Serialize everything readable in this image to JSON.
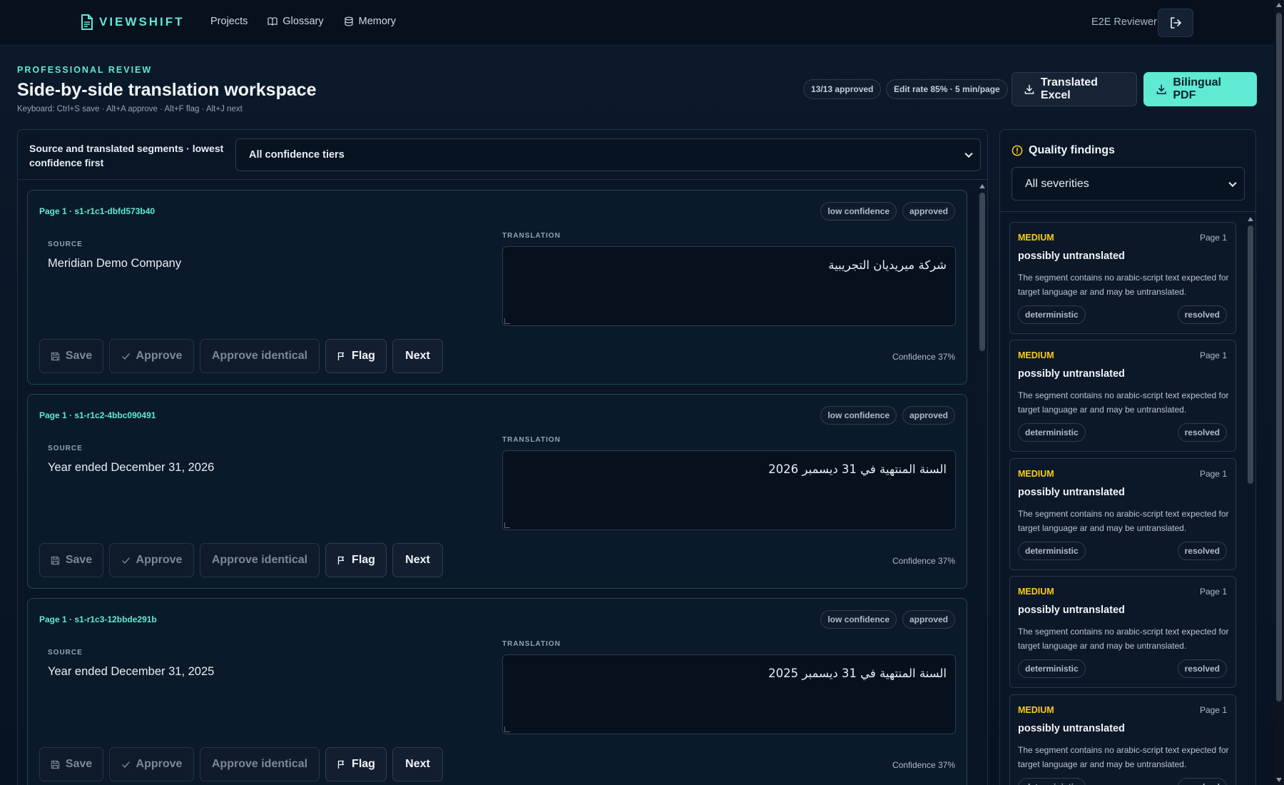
{
  "nav": {
    "brand": "VIEWSHIFT",
    "links": [
      {
        "label": "Projects",
        "icon": "none"
      },
      {
        "label": "Glossary",
        "icon": "book-icon"
      },
      {
        "label": "Memory",
        "icon": "database-icon"
      }
    ],
    "user": "E2E Reviewer",
    "logout_icon": "logout-icon"
  },
  "header": {
    "eyebrow": "PROFESSIONAL REVIEW",
    "title": "Side-by-side translation workspace",
    "shortcuts": "Keyboard: Ctrl+S save · Alt+A approve · Alt+F flag · Alt+J next",
    "approved_stat": "13/13 approved",
    "edit_stat": "Edit rate 85% · 5 min/page",
    "excel_label": "Translated Excel",
    "pdf_label": "Bilingual PDF"
  },
  "segments_panel": {
    "title": "Source and translated segments · lowest confidence first",
    "filter_value": "All confidence tiers",
    "source_label": "SOURCE",
    "translation_label": "TRANSLATION",
    "actions": {
      "save": "Save",
      "approve": "Approve",
      "approve_identical": "Approve identical",
      "flag": "Flag",
      "next": "Next"
    },
    "segments": [
      {
        "id": "Page 1 · s1-r1c1-dbfd573b40",
        "badges": [
          "low confidence",
          "approved"
        ],
        "source": "Meridian Demo Company",
        "translation": "شركة ميريديان التجريبية",
        "confidence": "Confidence 37%"
      },
      {
        "id": "Page 1 · s1-r1c2-4bbc090491",
        "badges": [
          "low confidence",
          "approved"
        ],
        "source": "Year ended December 31, 2026",
        "translation": "السنة المنتهية في 31 ديسمبر 2026",
        "confidence": "Confidence 37%"
      },
      {
        "id": "Page 1 · s1-r1c3-12bbde291b",
        "badges": [
          "low confidence",
          "approved"
        ],
        "source": "Year ended December 31, 2025",
        "translation": "السنة المنتهية في 31 ديسمبر 2025",
        "confidence": "Confidence 37%"
      }
    ]
  },
  "findings_panel": {
    "title": "Quality findings",
    "severity_filter": "All severities",
    "findings": [
      {
        "severity": "MEDIUM",
        "page": "Page 1",
        "title": "possibly untranslated",
        "desc": "The segment contains no arabic-script text expected for target language ar and may be untranslated.",
        "method": "deterministic",
        "status": "resolved"
      },
      {
        "severity": "MEDIUM",
        "page": "Page 1",
        "title": "possibly untranslated",
        "desc": "The segment contains no arabic-script text expected for target language ar and may be untranslated.",
        "method": "deterministic",
        "status": "resolved"
      },
      {
        "severity": "MEDIUM",
        "page": "Page 1",
        "title": "possibly untranslated",
        "desc": "The segment contains no arabic-script text expected for target language ar and may be untranslated.",
        "method": "deterministic",
        "status": "resolved"
      },
      {
        "severity": "MEDIUM",
        "page": "Page 1",
        "title": "possibly untranslated",
        "desc": "The segment contains no arabic-script text expected for target language ar and may be untranslated.",
        "method": "deterministic",
        "status": "resolved"
      },
      {
        "severity": "MEDIUM",
        "page": "Page 1",
        "title": "possibly untranslated",
        "desc": "The segment contains no arabic-script text expected for target language ar and may be untranslated.",
        "method": "deterministic",
        "status": "resolved"
      }
    ]
  },
  "colors": {
    "accent": "#5eead4",
    "warning": "#facc15",
    "background": "#0a1626"
  }
}
